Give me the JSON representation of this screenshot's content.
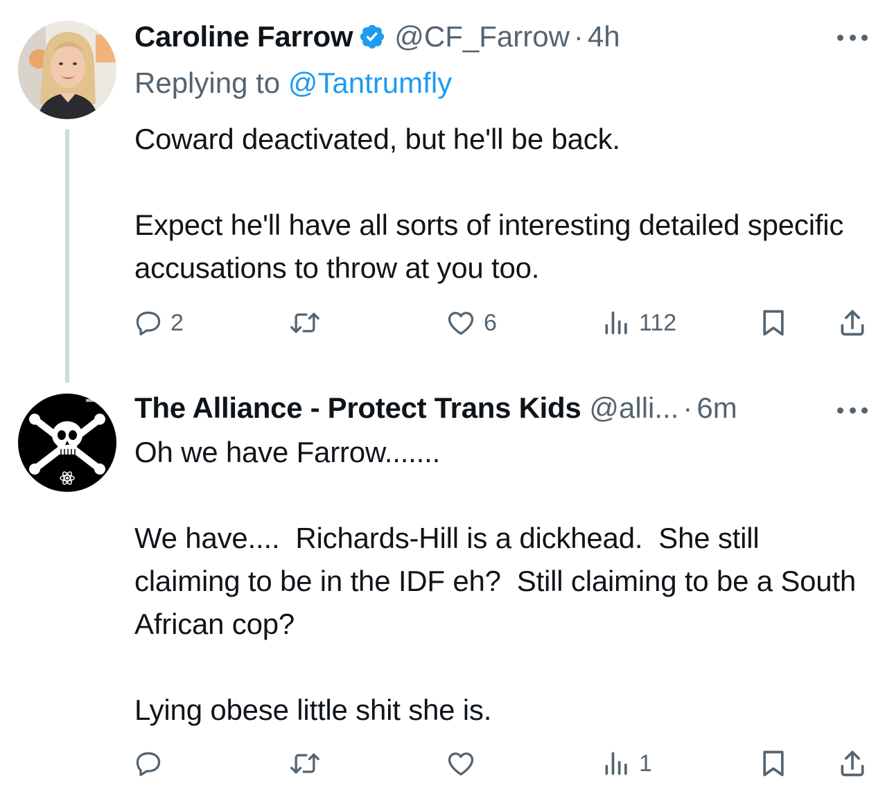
{
  "tweets": [
    {
      "display_name": "Caroline Farrow",
      "verified": true,
      "handle": "@CF_Farrow",
      "separator": "·",
      "time": "4h",
      "replying_prefix": "Replying to",
      "replying_handle": "@Tantrumfly",
      "text": "Coward deactivated, but he'll be back.\n\nExpect he'll have all sorts of interesting detailed specific accusations to throw at you too.",
      "counts": {
        "replies": "2",
        "retweets": "",
        "likes": "6",
        "views": "112"
      }
    },
    {
      "display_name": "The Alliance - Protect Trans Kids",
      "verified": false,
      "handle": "@alli...",
      "separator": "·",
      "time": "6m",
      "text": "Oh we have Farrow.......\n\nWe have....  Richards-Hill is a dickhead.  She still claiming to be in the IDF eh?  Still claiming to be a South African cop?\n\nLying obese little shit she is.",
      "counts": {
        "replies": "",
        "retweets": "",
        "likes": "",
        "views": "1"
      }
    }
  ],
  "icons": {
    "reply": "reply-icon",
    "retweet": "retweet-icon",
    "like": "heart-icon",
    "views": "views-icon",
    "bookmark": "bookmark-icon",
    "share": "share-icon",
    "more": "more-icon",
    "verified": "verified-badge-icon"
  },
  "colors": {
    "text": "#0f1419",
    "secondary": "#536471",
    "link": "#1d9bf0",
    "thread_line": "#cfd9de"
  }
}
